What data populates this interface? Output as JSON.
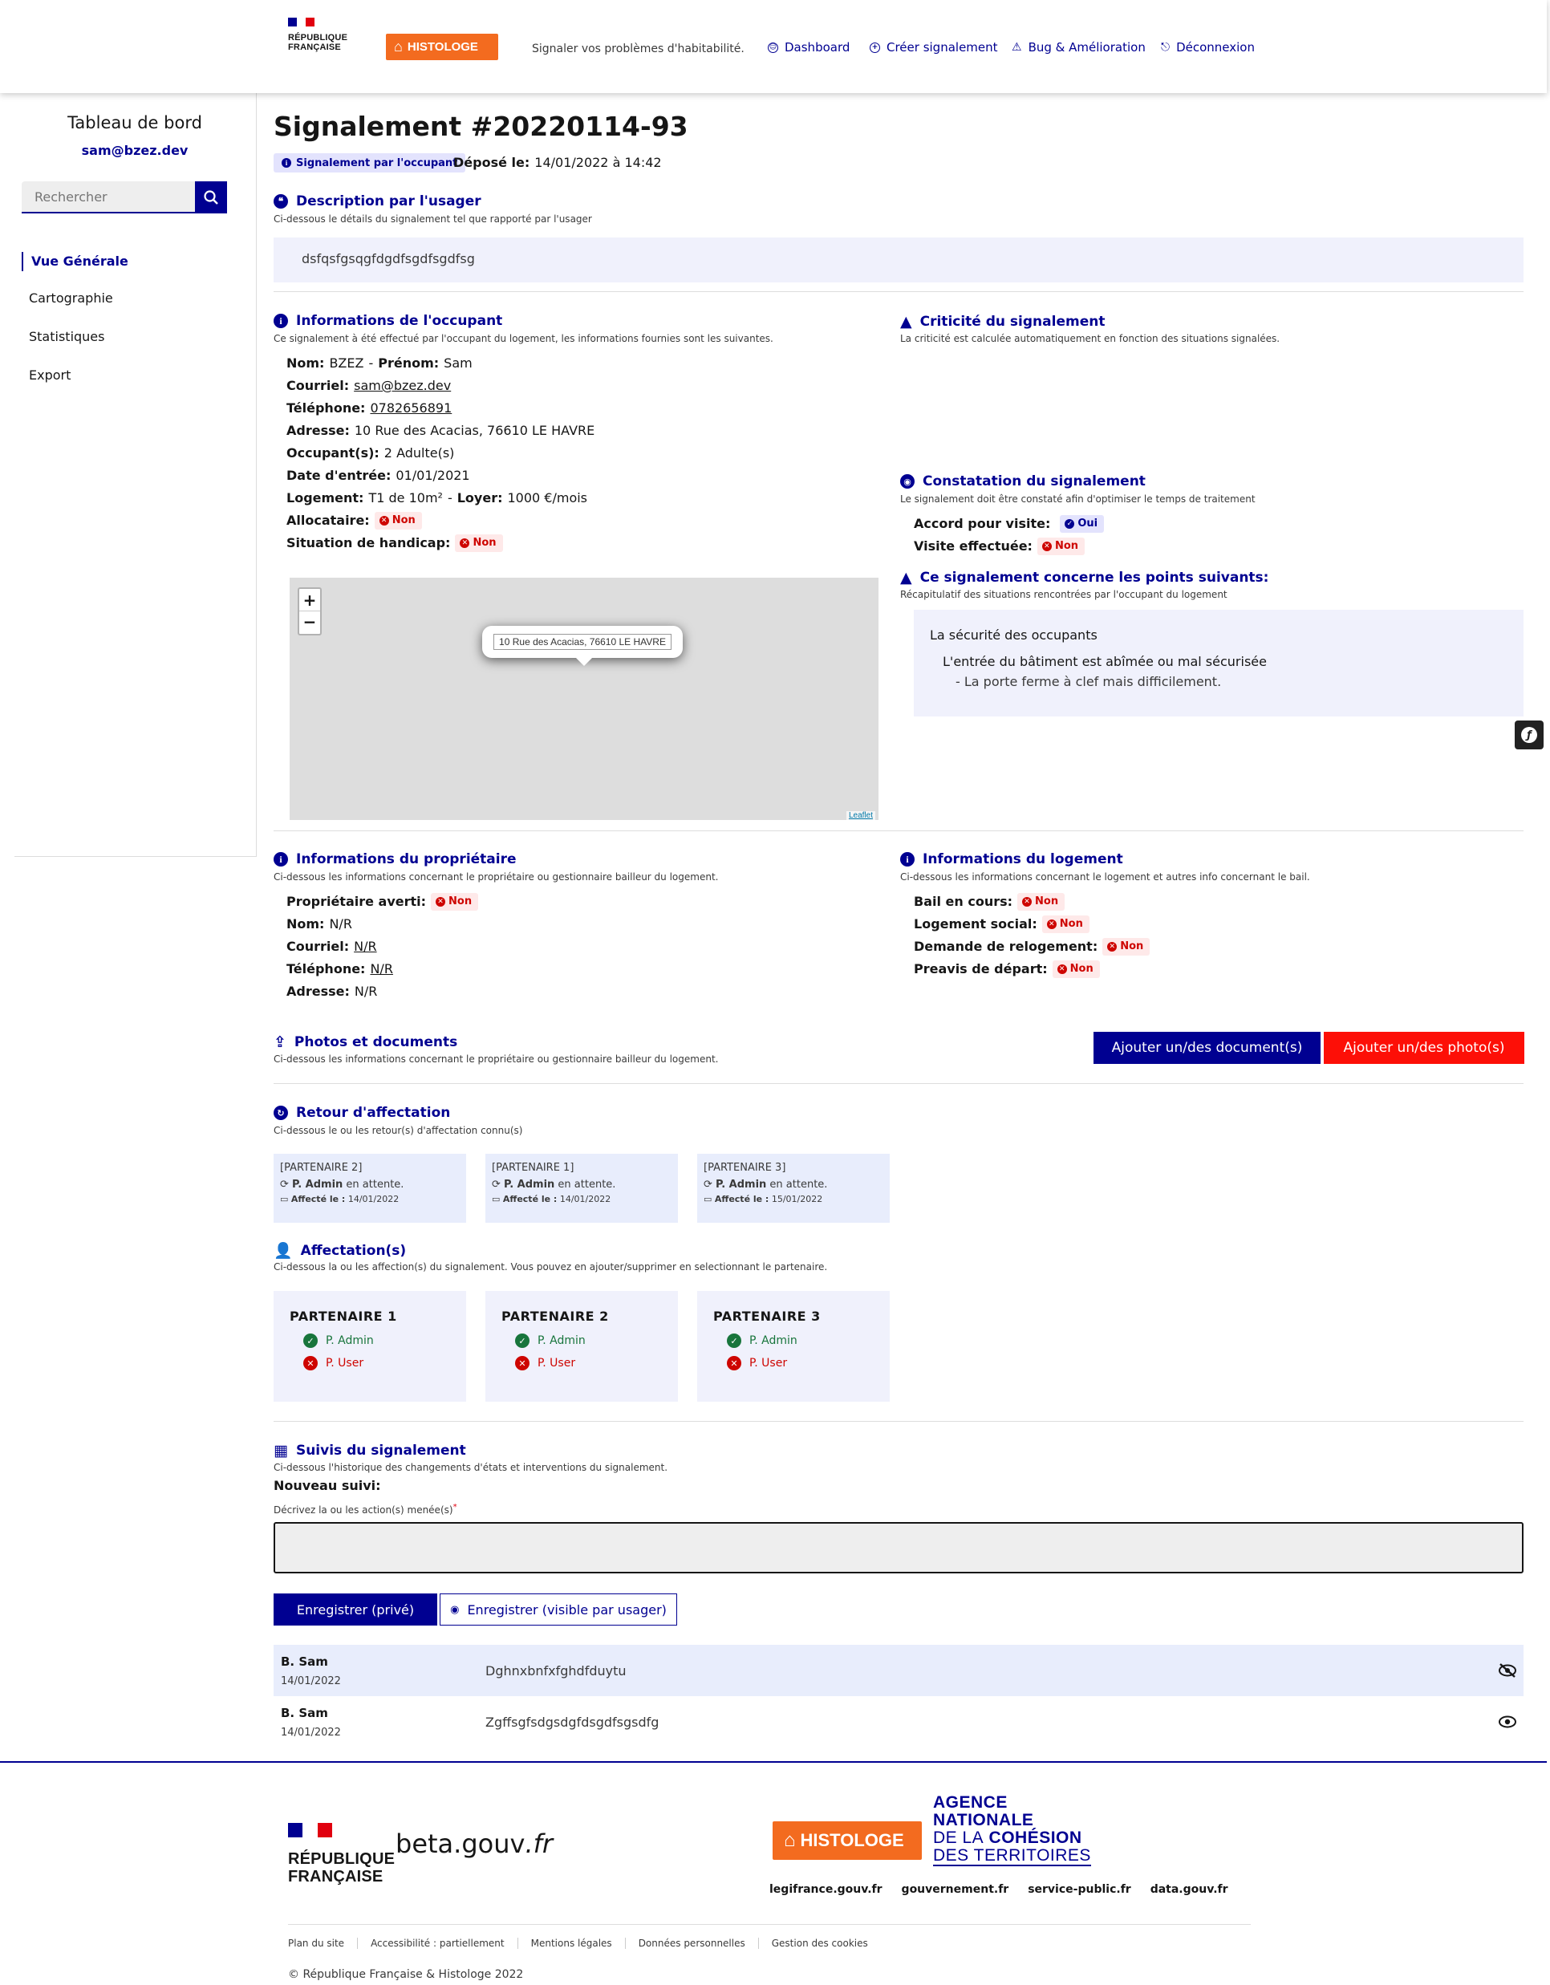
{
  "header": {
    "rf_line1": "RÉPUBLIQUE",
    "rf_line2": "FRANÇAISE",
    "logo": "HISTOLOGE",
    "tagline": "Signaler vos problèmes d'habitabilité.",
    "nav": [
      {
        "label": "Dashboard",
        "icon": "dashboard-icon"
      },
      {
        "label": "Créer signalement",
        "icon": "plus-icon"
      },
      {
        "label": "Bug & Amélioration",
        "icon": "warning-icon"
      },
      {
        "label": "Déconnexion",
        "icon": "logout-icon"
      }
    ]
  },
  "sidebar": {
    "title": "Tableau de bord",
    "email": "sam@bzez.dev",
    "search_placeholder": "Rechercher",
    "items": [
      "Vue Générale",
      "Cartographie",
      "Statistiques",
      "Export"
    ]
  },
  "signalement": {
    "title": "Signalement #20220114-93",
    "tag": "Signalement par l'occupant",
    "depose_label": "Déposé le:",
    "depose_value": "14/01/2022 à 14:42"
  },
  "description": {
    "title": "Description par l'usager",
    "subtitle": "Ci-dessous le détails du signalement tel que rapporté par l'usager",
    "text": "dsfqsfgsqgfdgdfsgdfsgdfsg"
  },
  "occupant": {
    "title": "Informations de l'occupant",
    "subtitle": "Ce signalement à été effectué par l'occupant du logement, les informations fournies sont les suivantes.",
    "nom_label": "Nom:",
    "nom": "BZEZ",
    "prenom_label": "Prénom:",
    "prenom": "Sam",
    "courriel_label": "Courriel:",
    "courriel": "sam@bzez.dev",
    "telephone_label": "Téléphone:",
    "telephone": "0782656891",
    "adresse_label": "Adresse:",
    "adresse": "10 Rue des Acacias, 76610 LE HAVRE",
    "occupants_label": "Occupant(s):",
    "occupants": "2 Adulte(s)",
    "date_label": "Date d'entrée:",
    "date": "01/01/2021",
    "logement_label": "Logement:",
    "logement": "T1 de 10m²",
    "loyer_label": "Loyer:",
    "loyer": "1000 €/mois",
    "allocataire_label": "Allocataire:",
    "allocataire": "Non",
    "handicap_label": "Situation de handicap:",
    "handicap": "Non"
  },
  "map": {
    "popup": "10 Rue des Acacias, 76610 LE HAVRE",
    "zoom_in": "+",
    "zoom_out": "−",
    "attribution": "Leaflet"
  },
  "criticite": {
    "title": "Criticité du signalement",
    "subtitle": "La criticité est calculée automatiquement en fonction des situations signalées."
  },
  "constatation": {
    "title": "Constatation du signalement",
    "subtitle": "Le signalement doit être constaté afin d'optimiser le temps de traitement",
    "accord_label": "Accord pour visite:",
    "accord": "Oui",
    "visite_label": "Visite effectuée:",
    "visite": "Non"
  },
  "points": {
    "title": "Ce signalement concerne les points suivants:",
    "subtitle": "Récapitulatif des situations rencontrées par l'occupant du logement",
    "situation": "La sécurité des occupants",
    "critere": "L'entrée du bâtiment est abîmée ou mal sécurisée",
    "detail": "- La porte ferme à clef mais difficilement."
  },
  "proprietaire": {
    "title": "Informations du propriétaire",
    "subtitle": "Ci-dessous les informations concernant le propriétaire ou gestionnaire bailleur du logement.",
    "averti_label": "Propriétaire averti:",
    "averti": "Non",
    "nom_label": "Nom:",
    "nom": "N/R",
    "courriel_label": "Courriel:",
    "courriel": "N/R",
    "telephone_label": "Téléphone:",
    "telephone": "N/R",
    "adresse_label": "Adresse:",
    "adresse": "N/R"
  },
  "logement": {
    "title": "Informations du logement",
    "subtitle": "Ci-dessous les informations concernant le logement et autres info concernant le bail.",
    "bail_label": "Bail en cours:",
    "bail": "Non",
    "social_label": "Logement social:",
    "social": "Non",
    "relogement_label": "Demande de relogement:",
    "relogement": "Non",
    "preavis_label": "Preavis de départ:",
    "preavis": "Non"
  },
  "photos": {
    "title": "Photos et documents",
    "subtitle": "Ci-dessous les informations concernant le propriétaire ou gestionnaire bailleur du logement.",
    "btn_documents": "Ajouter un/des document(s)",
    "btn_photos": "Ajouter un/des photo(s)"
  },
  "retour": {
    "title": "Retour d'affectation",
    "subtitle": "Ci-dessous le ou les retour(s) d'affectation connu(s)",
    "cards": [
      {
        "partenaire": "[PARTENAIRE 2]",
        "user": "P. Admin",
        "status": "en attente.",
        "affecte_label": "Affecté le :",
        "date": "14/01/2022"
      },
      {
        "partenaire": "[PARTENAIRE 1]",
        "user": "P. Admin",
        "status": "en attente.",
        "affecte_label": "Affecté le :",
        "date": "14/01/2022"
      },
      {
        "partenaire": "[PARTENAIRE 3]",
        "user": "P. Admin",
        "status": "en attente.",
        "affecte_label": "Affecté le :",
        "date": "15/01/2022"
      }
    ]
  },
  "affectations": {
    "title": "Affectation(s)",
    "subtitle": "Ci-dessous la ou les affection(s) du signalement. Vous pouvez en ajouter/supprimer en selectionnant le partenaire.",
    "cards": [
      {
        "name": "PARTENAIRE 1",
        "ok": "P. Admin",
        "ko": "P. User"
      },
      {
        "name": "PARTENAIRE 2",
        "ok": "P. Admin",
        "ko": "P. User"
      },
      {
        "name": "PARTENAIRE 3",
        "ok": "P. Admin",
        "ko": "P. User"
      }
    ]
  },
  "suivis": {
    "title": "Suivis du signalement",
    "subtitle": "Ci-dessous l'historique des changements d'états et interventions du signalement.",
    "nouveau": "Nouveau suivi:",
    "textarea_label": "Décrivez la ou les action(s) menée(s)",
    "required": "*",
    "btn_prive": "Enregistrer (privé)",
    "btn_visible": "Enregistrer (visible par usager)",
    "rows": [
      {
        "author": "B. Sam",
        "date": "14/01/2022",
        "text": "Dghnxbnfxfghdfduytu",
        "icon": "eye-off-icon"
      },
      {
        "author": "B. Sam",
        "date": "14/01/2022",
        "text": "Zgffsgfsdgsdgfdsgdfsgsdfg",
        "icon": "eye-icon"
      }
    ]
  },
  "footer": {
    "rf_line1": "RÉPUBLIQUE",
    "rf_line2": "FRANÇAISE",
    "beta": "beta.gouv",
    "beta_suffix": ".fr",
    "logo": "HISTOLOGE",
    "agence_1": "AGENCE",
    "agence_2": "NATIONALE",
    "agence_3a": "DE LA",
    "agence_3b": "COHÉSION",
    "agence_4": "DES TERRITOIRES",
    "links": [
      "legifrance.gouv.fr",
      "gouvernement.fr",
      "service-public.fr",
      "data.gouv.fr"
    ],
    "bottom_links": [
      "Plan du site",
      "Accessibilité : partiellement",
      "Mentions légales",
      "Données personnelles",
      "Gestion des cookies"
    ],
    "copyright": "© République Française & Histologe 2022"
  },
  "colors": {
    "primary": "#000091",
    "red": "#ce0500",
    "orange": "#f36b1f",
    "ok": "#18753c",
    "light": "#f0f1fc"
  }
}
